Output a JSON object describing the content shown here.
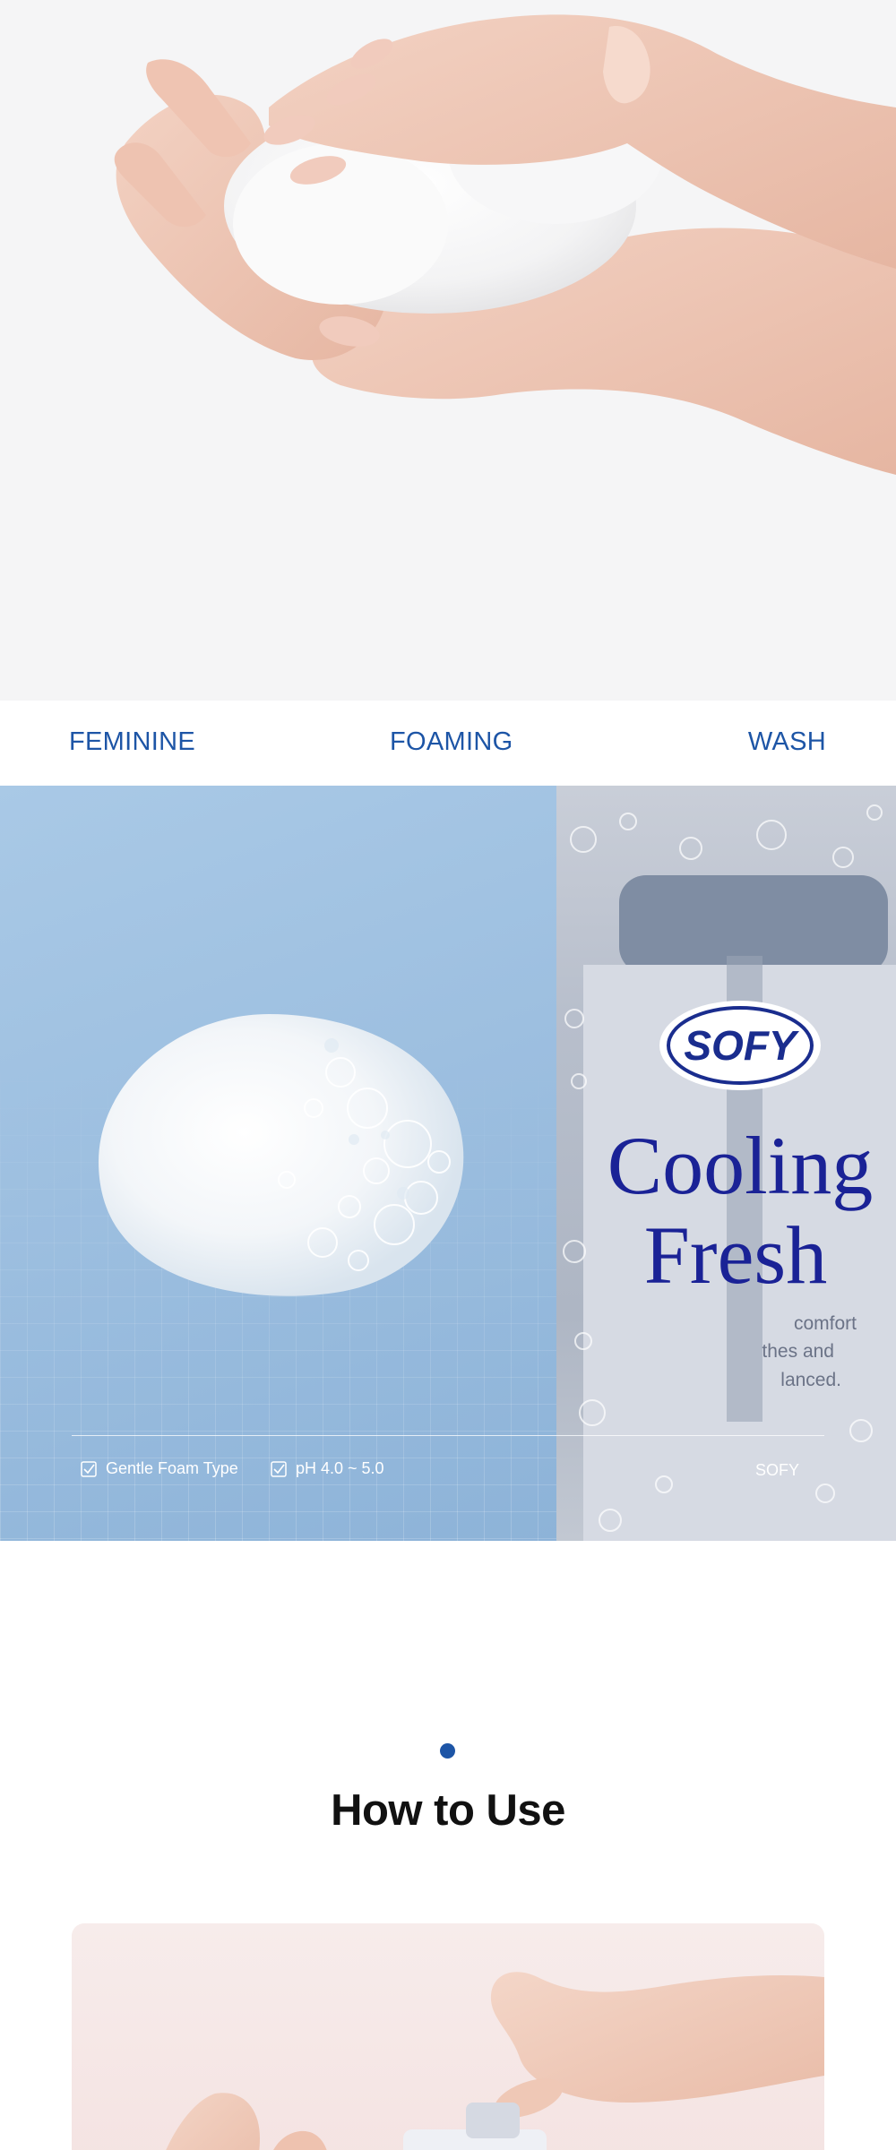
{
  "hero": {
    "image": "hands-holding-foam",
    "background": "#f5f5f6"
  },
  "title_band": {
    "words": [
      "FEMININE",
      "FOAMING",
      "WASH"
    ],
    "color": "#1d55a6"
  },
  "product_panel": {
    "foam_image": "foam-on-blue-grid",
    "bottle_label": {
      "logo": "SOFY",
      "line1": "Cooling",
      "line2": "Fresh",
      "small_text": [
        "comfort",
        "thes and",
        "lanced."
      ]
    },
    "features": [
      "Gentle Foam Type",
      "pH 4.0 ~ 5.0"
    ],
    "feature_icon": "checkbox-icon",
    "brand": "SOFY"
  },
  "how_to_use": {
    "title": "How to Use",
    "accent": "#1d55a6",
    "card_image": "hand-pressing-pump"
  }
}
